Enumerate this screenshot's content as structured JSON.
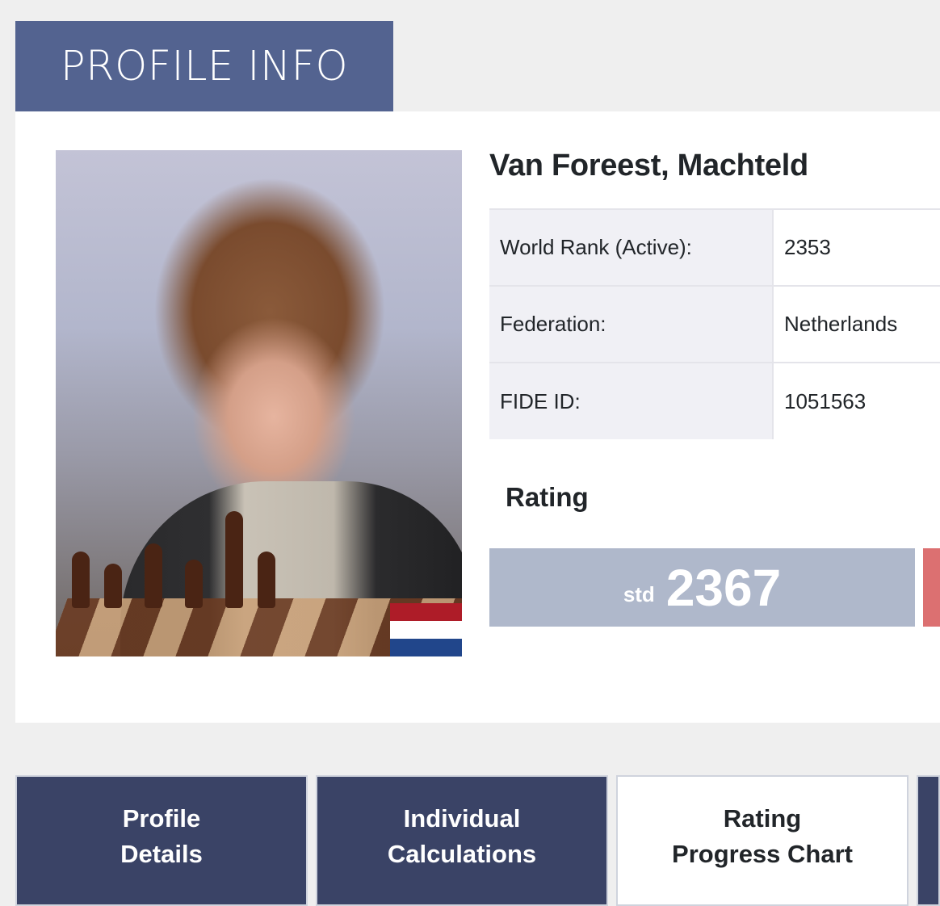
{
  "header": {
    "title": "PROFILE INFO"
  },
  "player": {
    "name": "Van Foreest, Machteld",
    "flag_colors": [
      "#ae1c28",
      "#ffffff",
      "#21468b"
    ]
  },
  "info": [
    {
      "label": "World Rank (Active):",
      "value": "2353"
    },
    {
      "label": "Federation:",
      "value": "Netherlands"
    },
    {
      "label": "FIDE ID:",
      "value": "1051563"
    }
  ],
  "rating": {
    "heading": "Rating",
    "std": {
      "label": "std",
      "value": "2367"
    }
  },
  "tabs": [
    {
      "line1": "Profile",
      "line2": "Details",
      "active": false
    },
    {
      "line1": "Individual",
      "line2": "Calculations",
      "active": false
    },
    {
      "line1": "Rating",
      "line2": "Progress Chart",
      "active": true
    }
  ],
  "colors": {
    "header_bg": "#536390",
    "tab_dark": "#3a4366",
    "rating_std_bg": "#afb8cb",
    "rating_next_bg": "#dc7071"
  }
}
